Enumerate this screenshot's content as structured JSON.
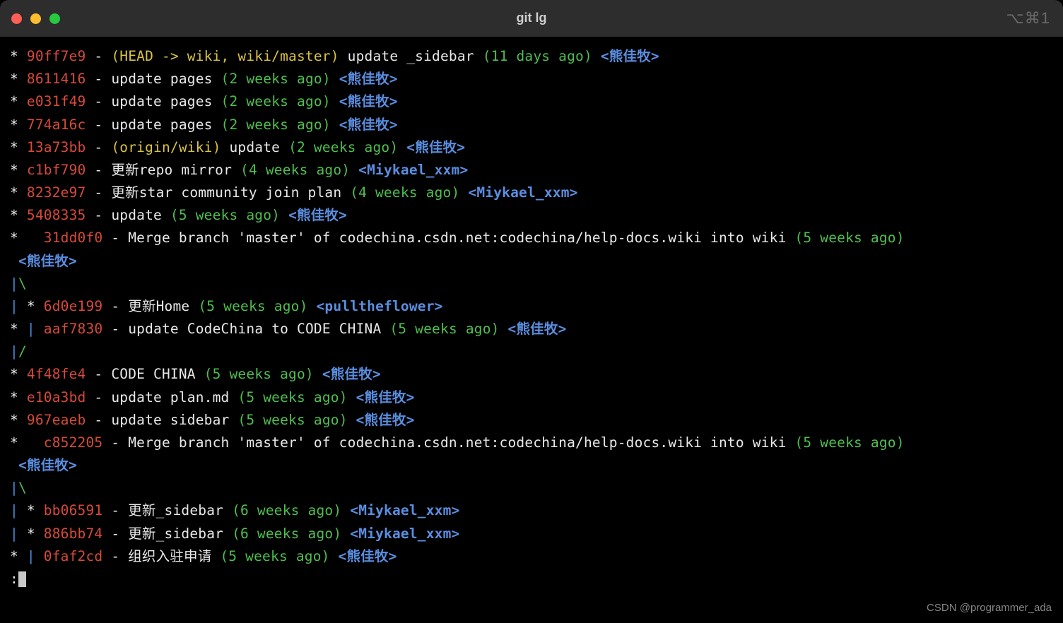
{
  "window": {
    "title": "git lg",
    "keybind": "⌥⌘1"
  },
  "lines": [
    {
      "type": "commit",
      "graph": "* ",
      "hash": "90ff7e9",
      "dash": " - ",
      "refs": "(HEAD -> wiki, wiki/master) ",
      "msg": "update _sidebar ",
      "age": "(11 days ago)",
      "author": " <熊佳牧>"
    },
    {
      "type": "commit",
      "graph": "* ",
      "hash": "8611416",
      "dash": " - ",
      "refs": "",
      "msg": "update pages ",
      "age": "(2 weeks ago)",
      "author": " <熊佳牧>"
    },
    {
      "type": "commit",
      "graph": "* ",
      "hash": "e031f49",
      "dash": " - ",
      "refs": "",
      "msg": "update pages ",
      "age": "(2 weeks ago)",
      "author": " <熊佳牧>"
    },
    {
      "type": "commit",
      "graph": "* ",
      "hash": "774a16c",
      "dash": " - ",
      "refs": "",
      "msg": "update pages ",
      "age": "(2 weeks ago)",
      "author": " <熊佳牧>"
    },
    {
      "type": "commit",
      "graph": "* ",
      "hash": "13a73bb",
      "dash": " - ",
      "refs": "(origin/wiki) ",
      "msg": "update ",
      "age": "(2 weeks ago)",
      "author": " <熊佳牧>"
    },
    {
      "type": "commit",
      "graph": "* ",
      "hash": "c1bf790",
      "dash": " - ",
      "refs": "",
      "msg": "更新repo mirror ",
      "age": "(4 weeks ago)",
      "author": " <Miykael_xxm>"
    },
    {
      "type": "commit",
      "graph": "* ",
      "hash": "8232e97",
      "dash": " - ",
      "refs": "",
      "msg": "更新star community join plan ",
      "age": "(4 weeks ago)",
      "author": " <Miykael_xxm>"
    },
    {
      "type": "commit",
      "graph": "* ",
      "hash": "5408335",
      "dash": " - ",
      "refs": "",
      "msg": "update ",
      "age": "(5 weeks ago)",
      "author": " <熊佳牧>"
    },
    {
      "type": "commit_wrap",
      "graph": "*   ",
      "hash": "31dd0f0",
      "dash": " - ",
      "refs": "",
      "msg": "Merge branch 'master' of codechina.csdn.net:codechina/help-docs.wiki into wiki ",
      "age": "(5 weeks ago)",
      "author_wrap": " <熊佳牧>"
    },
    {
      "type": "graph_only",
      "segments": [
        {
          "text": "|",
          "cls": "graph-blue"
        },
        {
          "text": "\\",
          "cls": "age"
        }
      ]
    },
    {
      "type": "commit",
      "graph_segments": [
        {
          "text": "|",
          "cls": "graph-blue"
        },
        {
          "text": " * ",
          "cls": "graph"
        }
      ],
      "hash": "6d0e199",
      "dash": " - ",
      "refs": "",
      "msg": "更新Home ",
      "age": "(5 weeks ago)",
      "author": " <pulltheflower>"
    },
    {
      "type": "commit",
      "graph_segments": [
        {
          "text": "* ",
          "cls": "graph"
        },
        {
          "text": "|",
          "cls": "graph-blue"
        },
        {
          "text": " ",
          "cls": "graph"
        }
      ],
      "hash": "aaf7830",
      "dash": " - ",
      "refs": "",
      "msg": "update CodeChina to CODE CHINA ",
      "age": "(5 weeks ago)",
      "author": " <熊佳牧>"
    },
    {
      "type": "graph_only",
      "segments": [
        {
          "text": "|",
          "cls": "graph-blue"
        },
        {
          "text": "/",
          "cls": "age"
        }
      ]
    },
    {
      "type": "commit",
      "graph": "* ",
      "hash": "4f48fe4",
      "dash": " - ",
      "refs": "",
      "msg": "CODE CHINA ",
      "age": "(5 weeks ago)",
      "author": " <熊佳牧>"
    },
    {
      "type": "commit",
      "graph": "* ",
      "hash": "e10a3bd",
      "dash": " - ",
      "refs": "",
      "msg": "update plan.md ",
      "age": "(5 weeks ago)",
      "author": " <熊佳牧>"
    },
    {
      "type": "commit",
      "graph": "* ",
      "hash": "967eaeb",
      "dash": " - ",
      "refs": "",
      "msg": "update sidebar ",
      "age": "(5 weeks ago)",
      "author": " <熊佳牧>"
    },
    {
      "type": "commit_wrap",
      "graph": "*   ",
      "hash": "c852205",
      "dash": " - ",
      "refs": "",
      "msg": "Merge branch 'master' of codechina.csdn.net:codechina/help-docs.wiki into wiki ",
      "age": "(5 weeks ago)",
      "author_wrap": " <熊佳牧>"
    },
    {
      "type": "graph_only",
      "segments": [
        {
          "text": "|",
          "cls": "graph-blue"
        },
        {
          "text": "\\",
          "cls": "age"
        }
      ]
    },
    {
      "type": "commit",
      "graph_segments": [
        {
          "text": "|",
          "cls": "graph-blue"
        },
        {
          "text": " * ",
          "cls": "graph"
        }
      ],
      "hash": "bb06591",
      "dash": " - ",
      "refs": "",
      "msg": "更新_sidebar ",
      "age": "(6 weeks ago)",
      "author": " <Miykael_xxm>"
    },
    {
      "type": "commit",
      "graph_segments": [
        {
          "text": "|",
          "cls": "graph-blue"
        },
        {
          "text": " * ",
          "cls": "graph"
        }
      ],
      "hash": "886bb74",
      "dash": " - ",
      "refs": "",
      "msg": "更新_sidebar ",
      "age": "(6 weeks ago)",
      "author": " <Miykael_xxm>"
    },
    {
      "type": "commit",
      "graph_segments": [
        {
          "text": "* ",
          "cls": "graph"
        },
        {
          "text": "|",
          "cls": "graph-blue"
        },
        {
          "text": " ",
          "cls": "graph"
        }
      ],
      "hash": "0faf2cd",
      "dash": " - ",
      "refs": "",
      "msg": "组织入驻申请 ",
      "age": "(5 weeks ago)",
      "author": " <熊佳牧>"
    }
  ],
  "prompt": ":",
  "watermark": "CSDN @programmer_ada"
}
